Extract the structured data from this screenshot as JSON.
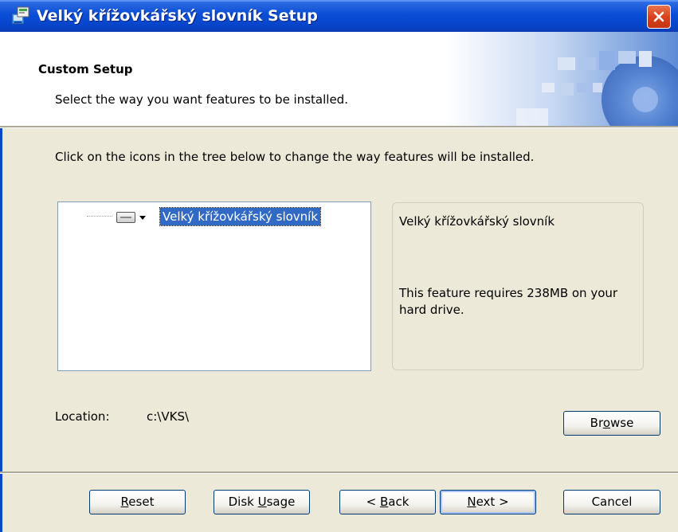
{
  "window": {
    "title": "Velký křížovkářský slovník Setup",
    "icon": "installer-icon"
  },
  "banner": {
    "heading": "Custom Setup",
    "subheading": "Select the way you want features to be installed."
  },
  "instruction": "Click on the icons in the tree below to change the way features will be installed.",
  "tree": {
    "items": [
      {
        "label": "Velký křížovkářský slovník",
        "icon": "drive-icon",
        "selected": true
      }
    ]
  },
  "description": {
    "feature_name": "Velký křížovkářský slovník",
    "requirement": "This feature requires 238MB on your hard drive."
  },
  "location": {
    "label": "Location:",
    "value": "c:\\VKS\\"
  },
  "buttons": {
    "browse": {
      "pre": "Br",
      "accel": "o",
      "post": "wse"
    },
    "reset": {
      "pre": "",
      "accel": "R",
      "post": "eset"
    },
    "disk_usage": {
      "pre": "Disk ",
      "accel": "U",
      "post": "sage"
    },
    "back": {
      "pre": "< ",
      "accel": "B",
      "post": "ack"
    },
    "next": {
      "pre": "",
      "accel": "N",
      "post": "ext >"
    },
    "cancel": {
      "label": "Cancel"
    }
  },
  "colors": {
    "titlebar": "#0A4ED6",
    "dialog_bg": "#ECE9D8",
    "selection": "#316AC5",
    "close_button": "#D8431E"
  }
}
